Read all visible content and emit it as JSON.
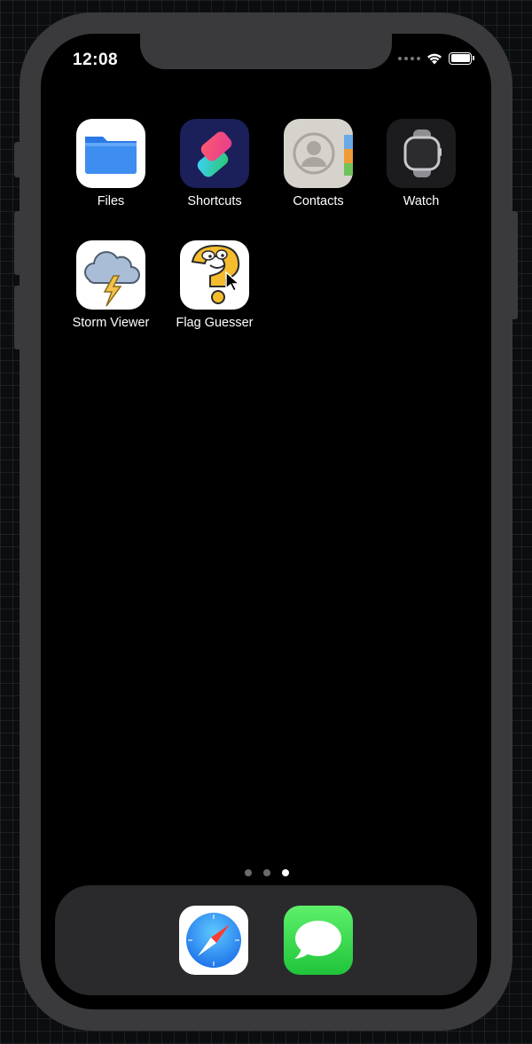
{
  "status_bar": {
    "time": "12:08"
  },
  "home_apps": [
    {
      "label": "Files",
      "icon": "files-folder-icon"
    },
    {
      "label": "Shortcuts",
      "icon": "shortcuts-icon"
    },
    {
      "label": "Contacts",
      "icon": "contacts-icon"
    },
    {
      "label": "Watch",
      "icon": "watch-icon"
    },
    {
      "label": "Storm Viewer",
      "icon": "storm-cloud-icon"
    },
    {
      "label": "Flag Guesser",
      "icon": "question-mark-mascot-icon"
    }
  ],
  "page_indicator": {
    "pages": 3,
    "active": 3
  },
  "dock": [
    {
      "name": "Safari",
      "icon": "safari-compass-icon"
    },
    {
      "name": "Messages",
      "icon": "messages-bubble-icon"
    }
  ]
}
